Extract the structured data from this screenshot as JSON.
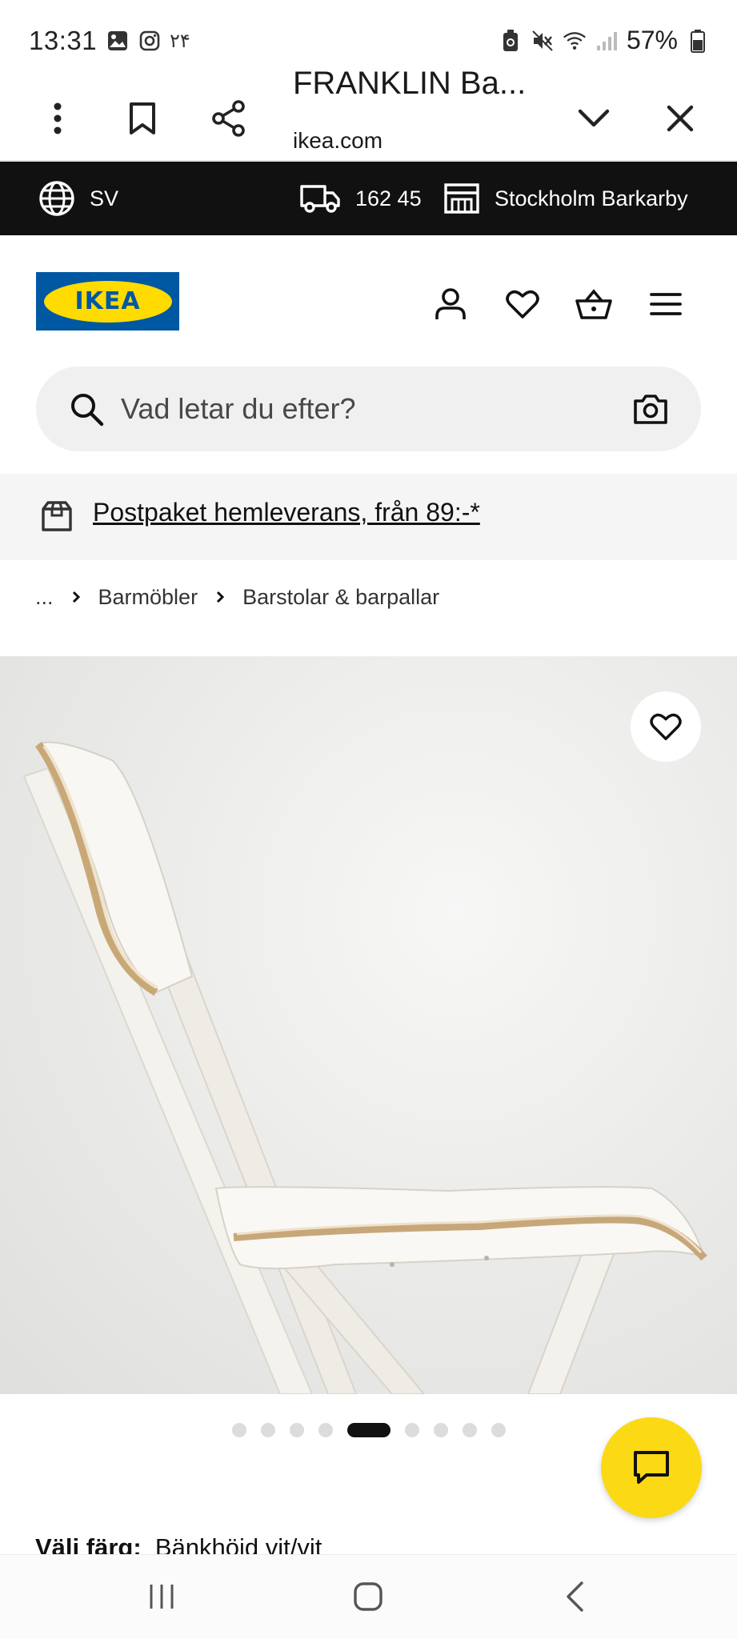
{
  "status_bar": {
    "time": "13:31",
    "notification_number": "۲۴",
    "battery": "57%",
    "icons": [
      "gallery-icon",
      "instagram-icon",
      "battery-saver-icon",
      "mute-icon",
      "wifi-icon",
      "signal-icon",
      "battery-icon"
    ]
  },
  "custom_tab": {
    "title": "FRANKLIN Ba...",
    "url": "ikea.com",
    "icons": [
      "more-vert-icon",
      "bookmark-icon",
      "share-icon",
      "chevron-down-icon",
      "close-icon"
    ]
  },
  "utility_bar": {
    "language": "SV",
    "postcode": "162 45",
    "store": "Stockholm Barkarby"
  },
  "header": {
    "logo_text": "IKEA",
    "colors": {
      "logo_blue": "#0058a3",
      "logo_yellow": "#ffdb00"
    },
    "icons": [
      "account-icon",
      "heart-icon",
      "basket-icon",
      "menu-icon"
    ]
  },
  "search": {
    "placeholder": "Vad letar du efter?"
  },
  "banner": {
    "text": "Postpaket hemleverans, från 89:-*"
  },
  "breadcrumb": {
    "ellipsis": "...",
    "items": [
      "Barmöbler",
      "Barstolar & barpallar"
    ]
  },
  "carousel": {
    "dot_count": 9,
    "active_index": 4
  },
  "chat": {
    "accent": "#fbd914"
  },
  "product": {
    "colour_label": "Välj färg:",
    "colour_value": "Bänkhöjd vit/vit"
  }
}
